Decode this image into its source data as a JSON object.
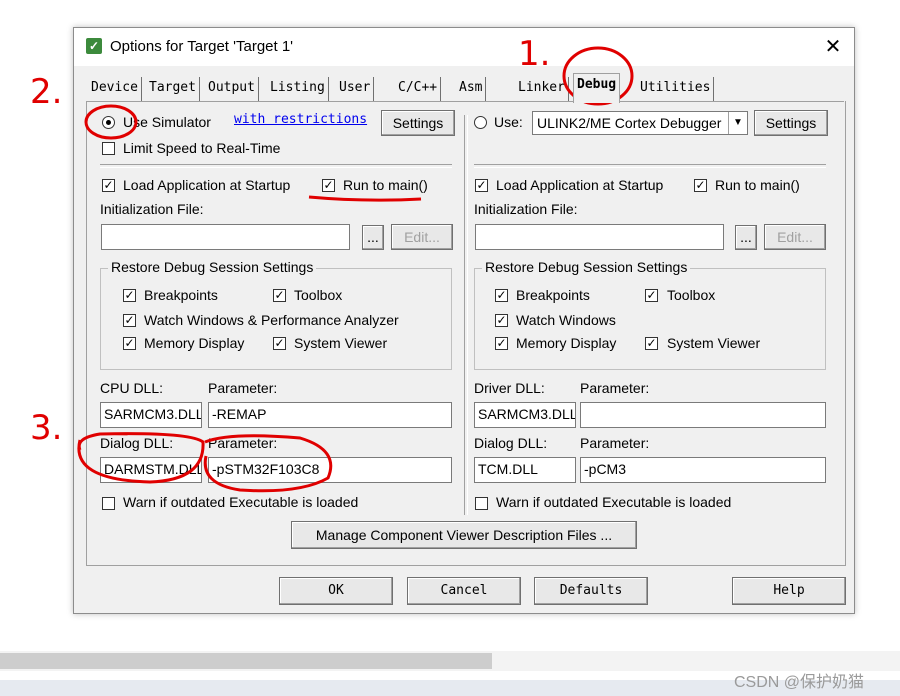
{
  "window": {
    "title": "Options for Target 'Target 1'",
    "close_label": "✕"
  },
  "tabs": [
    "Device",
    "Target",
    "Output",
    "Listing",
    "User",
    "C/C++",
    "Asm",
    "Linker",
    "Debug",
    "Utilities"
  ],
  "left": {
    "use_simulator_label": "Use Simulator",
    "restrictions_link": "with restrictions",
    "settings_label": "Settings",
    "limit_speed_label": "Limit Speed to Real-Time",
    "load_app_label": "Load Application at Startup",
    "run_main_label": "Run to main()",
    "init_file_label": "Initialization File:",
    "browse_label": "...",
    "edit_label": "Edit...",
    "restore_label": "Restore Debug Session Settings",
    "breakpoints_label": "Breakpoints",
    "toolbox_label": "Toolbox",
    "watch_label": "Watch Windows & Performance Analyzer",
    "memory_label": "Memory Display",
    "sysviewer_label": "System Viewer",
    "cpu_dll_label": "CPU DLL:",
    "param_label": "Parameter:",
    "cpu_dll_value": "SARMCM3.DLL",
    "cpu_param_value": "-REMAP",
    "dialog_dll_label": "Dialog DLL:",
    "dialog_dll_value": "DARMSTM.DLL",
    "dialog_param_value": "-pSTM32F103C8",
    "warn_label": "Warn if outdated Executable is loaded"
  },
  "right": {
    "use_label": "Use:",
    "debugger_value": "ULINK2/ME Cortex Debugger",
    "settings_label": "Settings",
    "load_app_label": "Load Application at Startup",
    "run_main_label": "Run to main()",
    "init_file_label": "Initialization File:",
    "browse_label": "...",
    "edit_label": "Edit...",
    "restore_label": "Restore Debug Session Settings",
    "breakpoints_label": "Breakpoints",
    "toolbox_label": "Toolbox",
    "watch_label": "Watch Windows",
    "memory_label": "Memory Display",
    "sysviewer_label": "System Viewer",
    "driver_dll_label": "Driver DLL:",
    "param_label": "Parameter:",
    "driver_dll_value": "SARMCM3.DLL",
    "driver_param_value": "",
    "dialog_dll_label": "Dialog DLL:",
    "dialog_dll_value": "TCM.DLL",
    "dialog_param_value": "-pCM3",
    "warn_label": "Warn if outdated Executable is loaded"
  },
  "manage_label": "Manage Component Viewer Description Files ...",
  "buttons": {
    "ok": "OK",
    "cancel": "Cancel",
    "defaults": "Defaults",
    "help": "Help"
  },
  "annotations": {
    "one": "1.",
    "two": "2.",
    "three": "3."
  },
  "watermark": "CSDN @保护奶猫",
  "colors": {
    "annotation": "#e00000",
    "link": "#0000ee"
  }
}
